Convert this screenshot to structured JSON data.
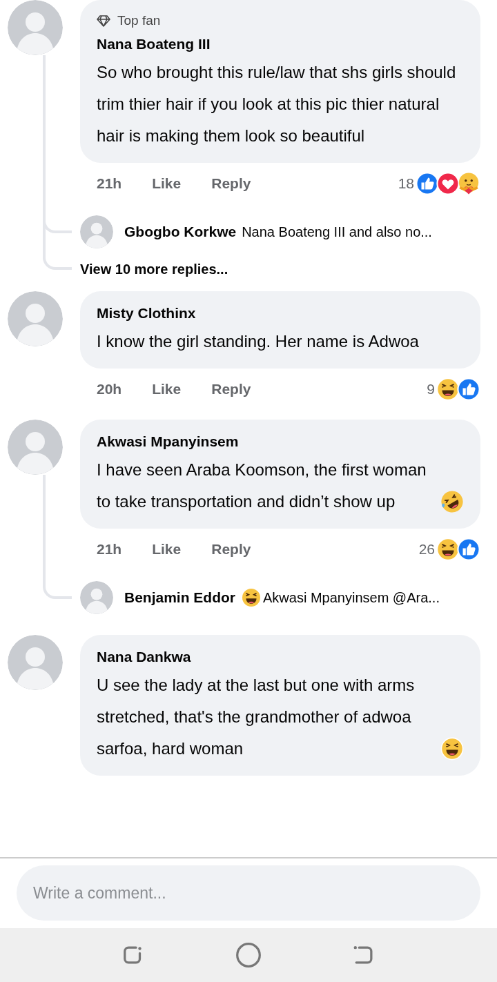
{
  "comments": [
    {
      "author": "Nana Boateng III",
      "badge": "Top fan",
      "body": "So who brought this rule/law that shs girls should trim thier hair if you look at this pic thier natural hair is making them look so beautiful",
      "time": "21h",
      "like": "Like",
      "reply": "Reply",
      "reaction_count": "18",
      "reactions": [
        {
          "kind": "like"
        },
        {
          "kind": "love"
        },
        {
          "kind": "care"
        }
      ],
      "replies": [
        {
          "author": "Gbogbo Korkwe",
          "text": "Nana Boateng III and also no..."
        }
      ],
      "more_replies": "View 10 more replies..."
    },
    {
      "author": "Misty Clothinx",
      "body": "I know the girl standing. Her name is Adwoa",
      "time": "20h",
      "like": "Like",
      "reply": "Reply",
      "reaction_count": "9",
      "reactions": [
        {
          "kind": "haha"
        },
        {
          "kind": "like"
        }
      ]
    },
    {
      "author": "Akwasi Mpanyinsem",
      "body": "I have seen Araba Koomson, the first woman to take transportation and didn’t show up",
      "body_emoji": {
        "kind": "rofl"
      },
      "time": "21h",
      "like": "Like",
      "reply": "Reply",
      "reaction_count": "26",
      "reactions": [
        {
          "kind": "haha"
        },
        {
          "kind": "like"
        }
      ],
      "replies": [
        {
          "author": "Benjamin Eddor",
          "emoji": {
            "kind": "haha"
          },
          "text": "Akwasi Mpanyinsem @Ara..."
        }
      ]
    },
    {
      "author": "Nana Dankwa",
      "body": "U see the lady at the last but one with arms stretched, that's the grandmother of adwoa sarfoa, hard woman",
      "body_emoji": {
        "kind": "haha"
      }
    }
  ],
  "composer": {
    "placeholder": "Write a comment..."
  }
}
